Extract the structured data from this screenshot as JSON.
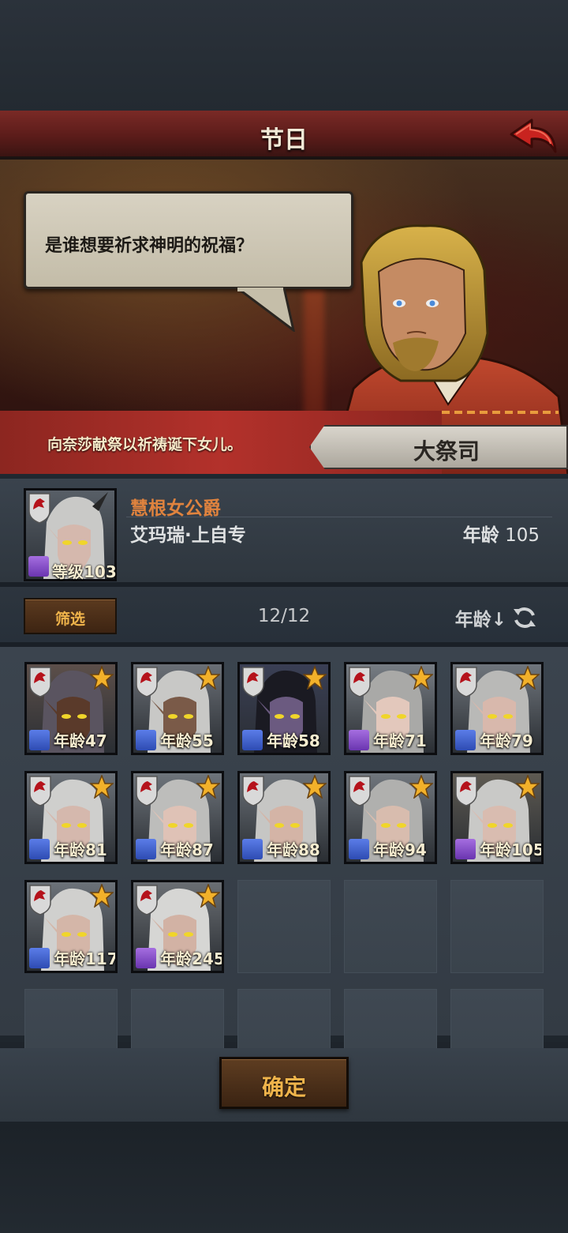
{
  "header": {
    "title": "节日",
    "back_icon": "back-arrow-icon"
  },
  "scene": {
    "dialogue": "是谁想要祈求神明的祝福？",
    "caption": "向奈莎献祭以祈祷诞下女儿。",
    "speaker": "大祭司"
  },
  "selected": {
    "title": "慧根女公爵",
    "name": "艾玛瑞·上自专",
    "age_label": "年龄",
    "age_value": "105",
    "level_text": "等级103",
    "class_icon": "staff-icon",
    "crest_icon": "wolf-crest-icon"
  },
  "filter": {
    "button_label": "筛选",
    "count": "12/12",
    "sort_label": "年龄↓",
    "refresh_icon": "refresh-icon"
  },
  "characters": [
    {
      "age": "年龄47",
      "class": "sword"
    },
    {
      "age": "年龄55",
      "class": "sword"
    },
    {
      "age": "年龄58",
      "class": "sword"
    },
    {
      "age": "年龄71",
      "class": "staff"
    },
    {
      "age": "年龄79",
      "class": "sword"
    },
    {
      "age": "年龄81",
      "class": "sword"
    },
    {
      "age": "年龄87",
      "class": "sword"
    },
    {
      "age": "年龄88",
      "class": "sword"
    },
    {
      "age": "年龄94",
      "class": "sword"
    },
    {
      "age": "年龄105",
      "class": "staff"
    },
    {
      "age": "年龄117",
      "class": "sword"
    },
    {
      "age": "年龄245",
      "class": "staff"
    }
  ],
  "footer": {
    "confirm_label": "确定"
  },
  "colors": {
    "title_bar": "#7a2a26",
    "accent_orange": "#e0833e",
    "button_gold": "#f0b44b",
    "sword_class": "#3b5fd0",
    "staff_class": "#8a4fd0"
  }
}
